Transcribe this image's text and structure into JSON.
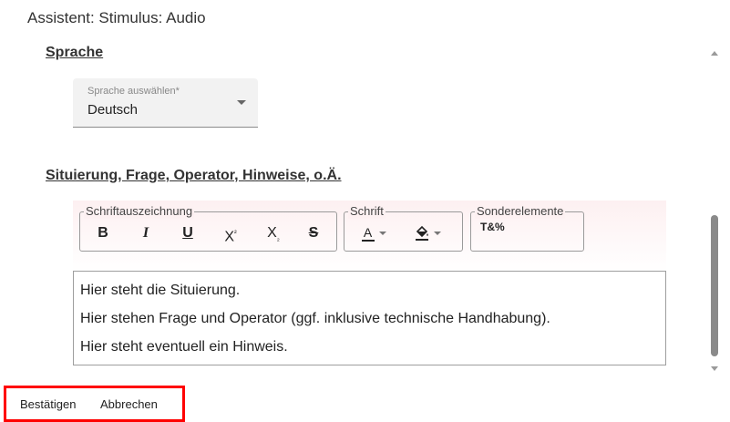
{
  "dialog": {
    "title": "Assistent: Stimulus: Audio"
  },
  "sprache_section": {
    "heading": "Sprache",
    "select": {
      "label": "Sprache auswählen*",
      "value": "Deutsch"
    }
  },
  "situierung_section": {
    "heading": "Situierung, Frage, Operator, Hinweise, o.Ä.",
    "toolbar": {
      "groups": [
        {
          "legend": "Schriftauszeichnung",
          "buttons": [
            "bold",
            "italic",
            "underline",
            "superscript",
            "subscript",
            "strikethrough"
          ]
        },
        {
          "legend": "Schrift",
          "buttons": [
            "font-color",
            "background-color"
          ]
        },
        {
          "legend": "Sonderelemente",
          "buttons": [
            "special-elements"
          ]
        }
      ],
      "labels": {
        "bold": "B",
        "italic": "I",
        "underline": "U",
        "superscript_base": "X",
        "superscript_mark": "²",
        "subscript_base": "X",
        "subscript_mark": "₂",
        "strikethrough": "S",
        "font_color": "A",
        "special": "T&%"
      }
    },
    "editor_lines": [
      "Hier steht die Situierung.",
      "Hier stehen Frage und Operator (ggf. inklusive technische Handhabung).",
      "Hier steht eventuell ein Hinweis."
    ]
  },
  "footer": {
    "confirm_label": "Bestätigen",
    "cancel_label": "Abbrechen"
  },
  "colors": {
    "highlight_border": "#ff0000",
    "toolbar_tint": "#fdf0f1",
    "scroll_thumb": "#8a8a8a"
  }
}
